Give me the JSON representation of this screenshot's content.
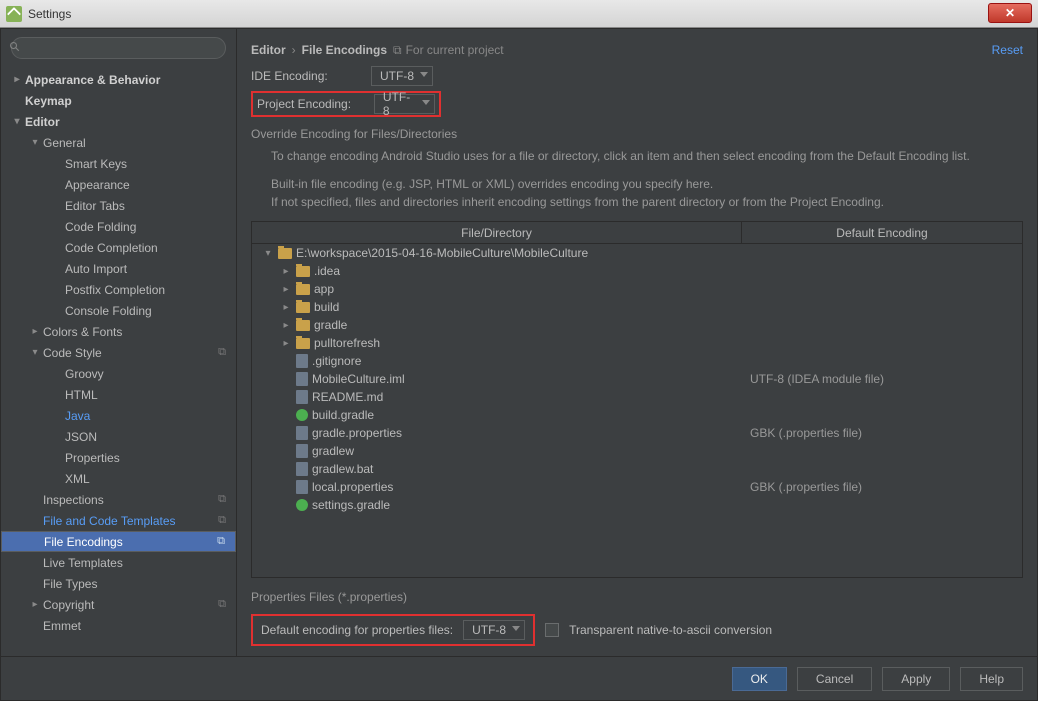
{
  "window": {
    "title": "Settings"
  },
  "search": {
    "placeholder": ""
  },
  "nav": {
    "appearance": "Appearance & Behavior",
    "keymap": "Keymap",
    "editor": "Editor",
    "general": "General",
    "smartkeys": "Smart Keys",
    "appearance2": "Appearance",
    "editortabs": "Editor Tabs",
    "codefolding": "Code Folding",
    "codecompletion": "Code Completion",
    "autoimport": "Auto Import",
    "postfix": "Postfix Completion",
    "consolefolding": "Console Folding",
    "colorsfonts": "Colors & Fonts",
    "codestyle": "Code Style",
    "groovy": "Groovy",
    "html": "HTML",
    "java": "Java",
    "json": "JSON",
    "properties": "Properties",
    "xml": "XML",
    "inspections": "Inspections",
    "fct": "File and Code Templates",
    "fileenc": "File Encodings",
    "livetpl": "Live Templates",
    "filetypes": "File Types",
    "copyright": "Copyright",
    "emmet": "Emmet"
  },
  "breadcrumb": {
    "a": "Editor",
    "b": "File Encodings",
    "proj": "For current project"
  },
  "reset": "Reset",
  "form": {
    "ideenc_lbl": "IDE Encoding:",
    "ideenc_val": "UTF-8",
    "projenc_lbl": "Project Encoding:",
    "projenc_val": "UTF-8",
    "override_title": "Override Encoding for Files/Directories",
    "help1": "To change encoding Android Studio uses for a file or directory, click an item and then select encoding from the Default Encoding list.",
    "help2": "Built-in file encoding (e.g. JSP, HTML or XML) overrides encoding you specify here.",
    "help3": "If not specified, files and directories inherit encoding settings from the parent directory or from the Project Encoding.",
    "col_file": "File/Directory",
    "col_enc": "Default Encoding",
    "props_section": "Properties Files (*.properties)",
    "props_lbl": "Default encoding for properties files:",
    "props_val": "UTF-8",
    "transparent": "Transparent native-to-ascii conversion"
  },
  "files": [
    {
      "d": 0,
      "exp": true,
      "icon": "folder",
      "name": "E:\\workspace\\2015-04-16-MobileCulture\\MobileCulture",
      "enc": ""
    },
    {
      "d": 1,
      "exp": false,
      "icon": "folder",
      "name": ".idea",
      "enc": ""
    },
    {
      "d": 1,
      "exp": false,
      "icon": "folder",
      "name": "app",
      "enc": ""
    },
    {
      "d": 1,
      "exp": false,
      "icon": "folder",
      "name": "build",
      "enc": ""
    },
    {
      "d": 1,
      "exp": false,
      "icon": "folder",
      "name": "gradle",
      "enc": ""
    },
    {
      "d": 1,
      "exp": false,
      "icon": "folder",
      "name": "pulltorefresh",
      "enc": ""
    },
    {
      "d": 1,
      "exp": null,
      "icon": "file",
      "name": ".gitignore",
      "enc": ""
    },
    {
      "d": 1,
      "exp": null,
      "icon": "file",
      "name": "MobileCulture.iml",
      "enc": "UTF-8 (IDEA module file)"
    },
    {
      "d": 1,
      "exp": null,
      "icon": "file",
      "name": "README.md",
      "enc": ""
    },
    {
      "d": 1,
      "exp": null,
      "icon": "gradle",
      "name": "build.gradle",
      "enc": ""
    },
    {
      "d": 1,
      "exp": null,
      "icon": "file",
      "name": "gradle.properties",
      "enc": "GBK (.properties file)"
    },
    {
      "d": 1,
      "exp": null,
      "icon": "file",
      "name": "gradlew",
      "enc": ""
    },
    {
      "d": 1,
      "exp": null,
      "icon": "file",
      "name": "gradlew.bat",
      "enc": ""
    },
    {
      "d": 1,
      "exp": null,
      "icon": "file",
      "name": "local.properties",
      "enc": "GBK (.properties file)"
    },
    {
      "d": 1,
      "exp": null,
      "icon": "gradle",
      "name": "settings.gradle",
      "enc": ""
    }
  ],
  "buttons": {
    "ok": "OK",
    "cancel": "Cancel",
    "apply": "Apply",
    "help": "Help"
  }
}
